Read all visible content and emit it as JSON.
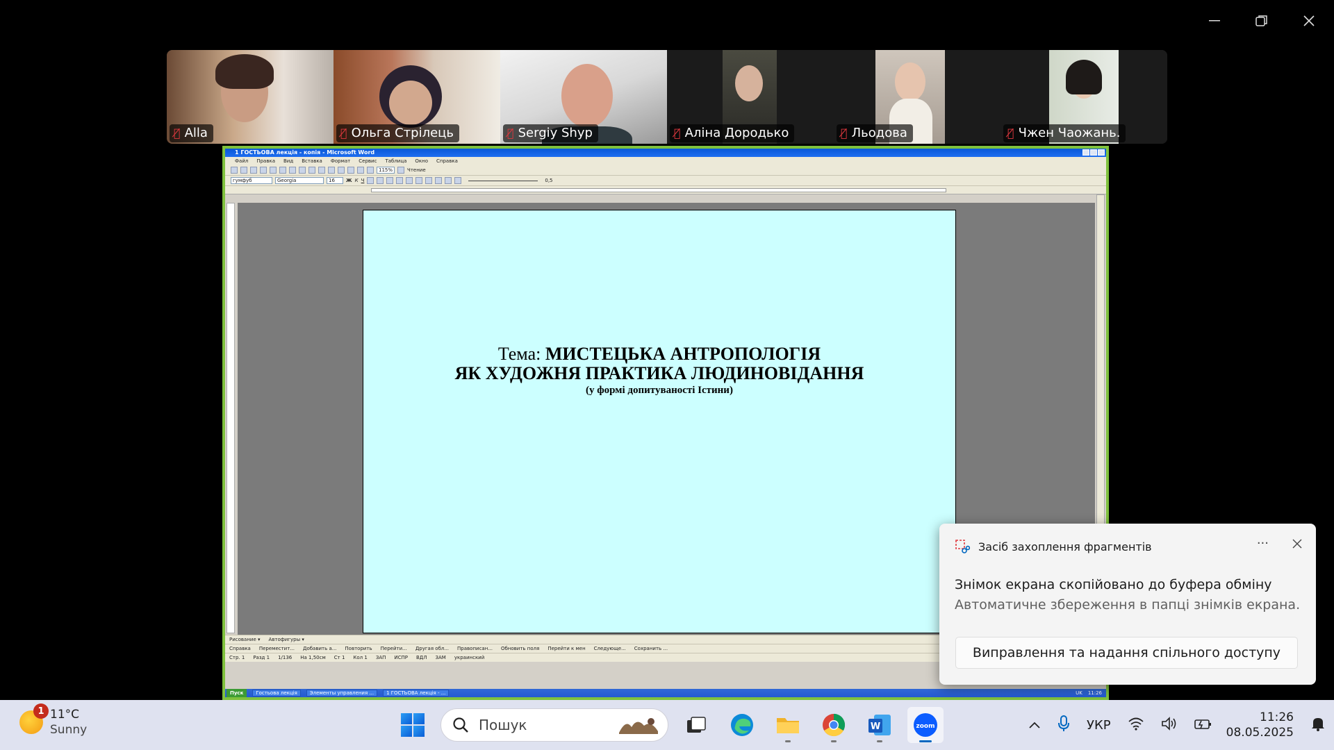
{
  "participants": [
    {
      "name": "Alla",
      "muted": true
    },
    {
      "name": "Ольга Стрілець",
      "muted": true
    },
    {
      "name": "Sergiy Shyp",
      "muted": true
    },
    {
      "name": "Аліна Дородько",
      "muted": true
    },
    {
      "name": "Льодова",
      "muted": true
    },
    {
      "name": "Чжен Чаожань.",
      "muted": true
    }
  ],
  "word": {
    "window_title": "1 ГОСТЬОВА лекція - копія - Microsoft Word",
    "menu": [
      "Файл",
      "Правка",
      "Вид",
      "Вставка",
      "Формат",
      "Сервис",
      "Таблица",
      "Окно",
      "Справка"
    ],
    "zoom": "115%",
    "read_mode": "Чтение",
    "style_value": "гумфуб",
    "font_value": "Georgia",
    "font_size": "16",
    "line_width": "0,5",
    "doc": {
      "line1_prefix": "Тема: ",
      "line1_bold": "МИСТЕЦЬКА АНТРОПОЛОГІЯ",
      "line2": "ЯК  ХУДОЖНЯ ПРАКТИКА  ЛЮДИНОВІДАННЯ",
      "line3": "(у формі допитуваності  Істини)"
    },
    "drawing_bar": [
      "Рисование ▾",
      "Автофигуры ▾"
    ],
    "bottom_bar": [
      "Справка",
      "Переместит...",
      "Добавить а...",
      "Повторить",
      "Перейти...",
      "Другая обл...",
      "Правописан...",
      "Обновить поля",
      "Перейти к мен",
      "Следующе...",
      "Сохранить ..."
    ],
    "status": [
      "Стр. 1",
      "Разд 1",
      "1/136",
      "На 1,50см",
      "Ст 1",
      "Кол 1",
      "ЗАП",
      "ИСПР",
      "ВДЛ",
      "ЗАМ",
      "украинский"
    ],
    "xp_taskbar": {
      "start": "Пуск",
      "tasks": [
        "Гостьова лекція",
        "Элементы управления ...",
        "1 ГОСТЬОВА лекція - ..."
      ],
      "lang": "UK",
      "time": "11:26"
    }
  },
  "toast": {
    "app": "Засіб захоплення фрагментів",
    "title": "Знімок екрана скопійовано до буфера обміну",
    "subtitle": "Автоматичне збереження в папці знімків екрана.",
    "action": "Виправлення та надання спільного доступу"
  },
  "taskbar": {
    "weather_temp": "11°C",
    "weather_cond": "Sunny",
    "weather_badge": "1",
    "search_placeholder": "Пошук",
    "lang": "УКР",
    "time": "11:26",
    "date": "08.05.2025"
  }
}
